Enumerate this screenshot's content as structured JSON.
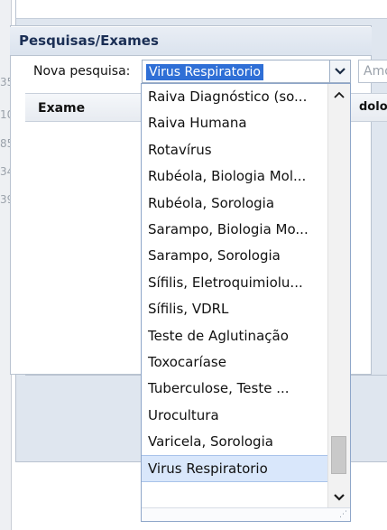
{
  "background": {
    "left_numbers": [
      "35",
      "10",
      "85",
      "34",
      "39"
    ]
  },
  "form": {
    "title": "Pesquisas/Exames",
    "nova_pesquisa_label": "Nova pesquisa:",
    "selected_value": "Virus Respiratorio",
    "amostra_placeholder": "Amo"
  },
  "table": {
    "headers": [
      "Exame",
      "dolog"
    ]
  },
  "dropdown": {
    "items": [
      "Raiva Diagnóstico (so...",
      "Raiva Humana",
      "Rotavírus",
      "Rubéola, Biologia Mol...",
      "Rubéola, Sorologia",
      "Sarampo, Biologia Mo...",
      "Sarampo, Sorologia",
      "Sífilis, Eletroquimiolu...",
      "Sífilis, VDRL",
      "Teste de Aglutinação",
      "Toxocaríase",
      "Tuberculose, Teste ...",
      "Urocultura",
      "Varicela, Sorologia",
      "Virus Respiratorio"
    ],
    "selected_index": 14
  },
  "colors": {
    "selection_blue": "#2f6fd6",
    "panel_bg": "#dfe6ef",
    "title_text": "#1b2f55"
  }
}
